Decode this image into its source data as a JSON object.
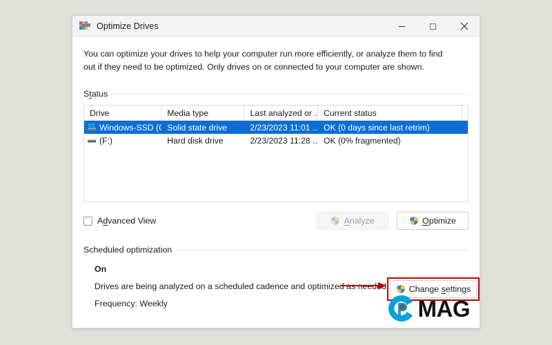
{
  "window": {
    "title": "Optimize Drives",
    "app_icon": "defrag-blocks-icon",
    "controls": {
      "minimize": "minimize-icon",
      "maximize": "maximize-icon",
      "close": "close-icon"
    }
  },
  "intro": "You can optimize your drives to help your computer run more efficiently, or analyze them to find out if they need to be optimized. Only drives on or connected to your computer are shown.",
  "status_group": {
    "label_pre": "S",
    "label_acc": "t",
    "label_post": "atus",
    "label_full": "Status"
  },
  "table": {
    "columns": [
      "Drive",
      "Media type",
      "Last analyzed or ...",
      "Current status",
      ""
    ],
    "rows": [
      {
        "icon": "system-drive-icon",
        "drive": "Windows-SSD (C:)",
        "media_type": "Solid state drive",
        "last_analyzed": "2/23/2023 11:01 ...",
        "current_status": "OK (0 days since last retrim)",
        "selected": true
      },
      {
        "icon": "hard-disk-icon",
        "drive": "(F:)",
        "media_type": "Hard disk drive",
        "last_analyzed": "2/23/2023 11:28 ...",
        "current_status": "OK (0% fragmented)",
        "selected": false
      }
    ]
  },
  "actions": {
    "advanced_view": {
      "pre": "A",
      "acc": "d",
      "post": "vanced View",
      "checked": false
    },
    "analyze": {
      "pre": "",
      "acc": "A",
      "post": "nalyze",
      "disabled": true,
      "icon": "uac-shield-icon"
    },
    "optimize": {
      "pre": "",
      "acc": "O",
      "post": "ptimize",
      "disabled": false,
      "icon": "uac-shield-icon"
    }
  },
  "scheduled": {
    "group_label": "Scheduled optimization",
    "state": "On",
    "description": "Drives are being analyzed on a scheduled cadence and optimized as needed.",
    "frequency": "Frequency: Weekly",
    "change_settings": {
      "pre": "Change ",
      "acc": "s",
      "post": "ettings",
      "icon": "uac-shield-icon"
    }
  },
  "annotation": {
    "highlight_color": "#c00000",
    "arrow": "red-arrow-icon"
  },
  "watermark": {
    "mark": "cmag-logo-icon",
    "text": "MAG",
    "mark_color": "#0aa0dc"
  },
  "colors": {
    "selection": "#0c6ed5",
    "desktop": "#dfe1da",
    "window": "#ffffff",
    "titlebar": "#f3f3f3"
  }
}
